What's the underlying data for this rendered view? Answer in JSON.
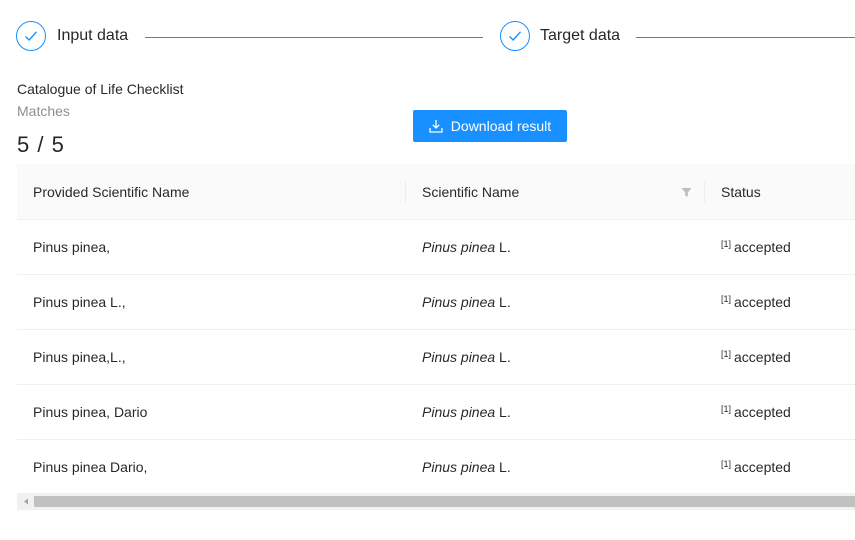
{
  "steps": [
    {
      "title": "Input data",
      "status": "finished"
    },
    {
      "title": "Target data",
      "status": "finished"
    }
  ],
  "source": {
    "title": "Catalogue of Life Checklist"
  },
  "stats": {
    "title": "Matches",
    "value": "5 / 5"
  },
  "download": {
    "label": "Download result",
    "icon": "download-icon"
  },
  "table": {
    "columns": [
      "Provided Scientific Name",
      "Scientific Name",
      "Status"
    ],
    "rows": [
      {
        "provided": "Pinus pinea,",
        "sci_italic": "Pinus pinea",
        "sci_author": " L.",
        "ref": "[1]",
        "status": "accepted"
      },
      {
        "provided": "Pinus pinea L.,",
        "sci_italic": "Pinus pinea",
        "sci_author": " L.",
        "ref": "[1]",
        "status": "accepted"
      },
      {
        "provided": "Pinus pinea,L.,",
        "sci_italic": "Pinus pinea",
        "sci_author": " L.",
        "ref": "[1]",
        "status": "accepted"
      },
      {
        "provided": "Pinus pinea, Dario",
        "sci_italic": "Pinus pinea",
        "sci_author": " L.",
        "ref": "[1]",
        "status": "accepted"
      },
      {
        "provided": "Pinus pinea Dario,",
        "sci_italic": "Pinus pinea",
        "sci_author": " L.",
        "ref": "[1]",
        "status": "accepted"
      }
    ]
  },
  "colors": {
    "primary": "#1890ff",
    "header_bg": "#fafafa",
    "border": "#f0f0f0"
  }
}
